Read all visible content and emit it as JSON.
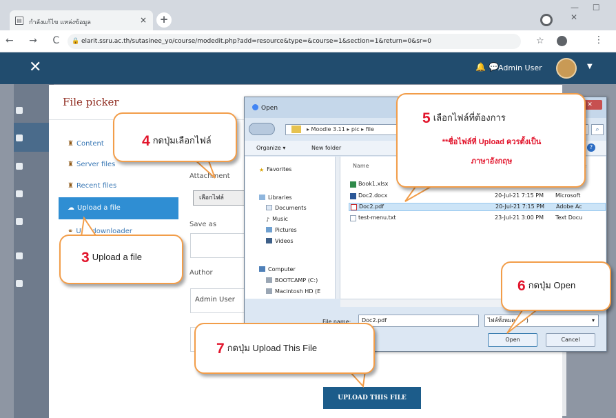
{
  "browser": {
    "tab_title": "กำลังแก้ไข แหล่งข้อมูล",
    "tab_close": "×",
    "new_tab": "+",
    "url": "elarit.ssru.ac.th/sutasinee_yo/course/modedit.php?add=resource&type=&course=1&section=1&return=0&sr=0",
    "nav_glyphs": "← → C",
    "star": "☆",
    "menu": "⋮",
    "window_controls": "— ☐ ✕"
  },
  "moodle_header": {
    "menu_glyph": "✕",
    "user_name": "Admin User",
    "bell": "🔔",
    "chat": "💬",
    "caret": "▼"
  },
  "file_picker": {
    "title": "File picker",
    "repositories": [
      {
        "label": "Content"
      },
      {
        "label": "Server files"
      },
      {
        "label": "Recent files"
      },
      {
        "label": "Upload a file"
      },
      {
        "label": "URL downloader"
      }
    ],
    "attachment_label": "Attachment",
    "choose_file_button": "เลือกไฟล์",
    "save_as_label": "Save as",
    "author_label": "Author",
    "author_value": "Admin User",
    "upload_button": "UPLOAD THIS FILE"
  },
  "open_dialog": {
    "title": "Open",
    "path": "▸ Moodle 3.11 ▸ pic ▸ file",
    "organize": "Organize ▾",
    "new_folder": "New folder",
    "nav_favorites": "Favorites",
    "nav_libraries": "Libraries",
    "nav_documents": "Documents",
    "nav_music": "Music",
    "nav_pictures": "Pictures",
    "nav_videos": "Videos",
    "nav_computer": "Computer",
    "nav_bootcamp": "BOOTCAMP (C:)",
    "nav_macintosh": "Macintosh HD (E",
    "col_name": "Name",
    "col_type": "e",
    "files": [
      {
        "name": "Book1.xlsx",
        "date": "",
        "type": "icrosoft"
      },
      {
        "name": "Doc2.docx",
        "date": "20-Jul-21 7:15 PM",
        "type": "Microsoft"
      },
      {
        "name": "Doc2.pdf",
        "date": "20-Jul-21 7:15 PM",
        "type": "Adobe Ac"
      },
      {
        "name": "test-menu.txt",
        "date": "23-Jul-21 3:00 PM",
        "type": "Text Docu"
      }
    ],
    "file_name_label": "File name:",
    "file_name_value": "Doc2.pdf",
    "file_type_value": "ไฟล์ทั้งหมด (*.*)",
    "open_button": "Open",
    "cancel_button": "Cancel"
  },
  "callouts": {
    "c3_num": "3",
    "c3_text": "Upload a file",
    "c4_num": "4",
    "c4_text": "กดปุ่มเลือกไฟล์",
    "c5_num": "5",
    "c5_text": "เลือกไฟล์ที่ต้องการ",
    "c5_warn1": "**ชื่อไฟล์ที่ Upload ควรตั้งเป็น",
    "c5_warn2": "ภาษาอังกฤษ",
    "c6_num": "6",
    "c6_text": "กดปุ่ม Open",
    "c7_num": "7",
    "c7_text": "กดปุ่ม Upload This File"
  },
  "colors": {
    "header": "#214c6e",
    "callout_border": "#f29d49",
    "callout_number": "#e2152c",
    "selected_repo": "#2f8ed3",
    "upload_button": "#1c5c8a"
  }
}
